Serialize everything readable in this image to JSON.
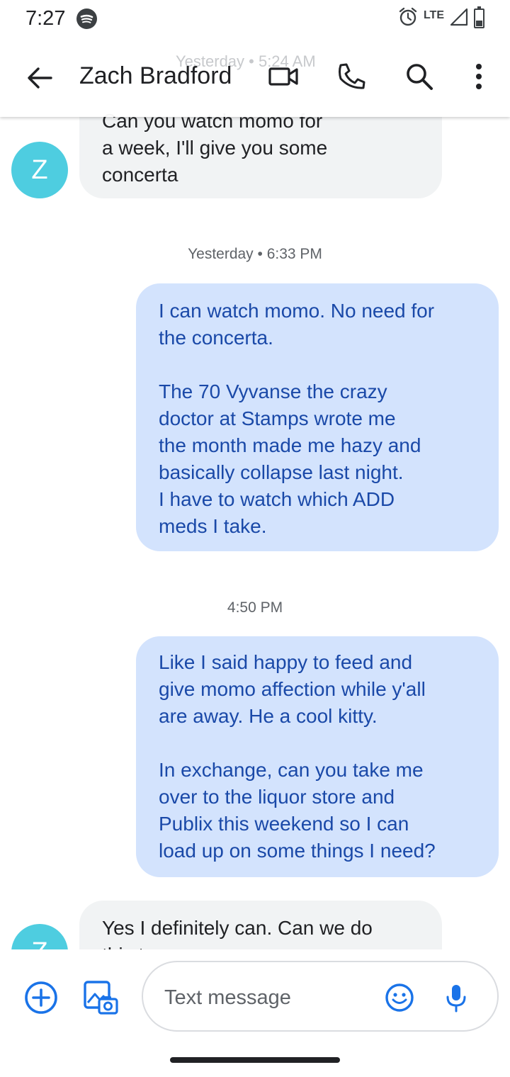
{
  "status_bar": {
    "time": "7:27",
    "network": "LTE",
    "battery": "33",
    "battery_fraction": 0.33,
    "icons": [
      "spotify-icon",
      "alarm-icon",
      "signal-icon",
      "battery-icon"
    ]
  },
  "toolbar": {
    "contact_name": "Zach Bradford",
    "behind_timestamp": "Yesterday • 5:24 AM",
    "icons": [
      "back-arrow-icon",
      "video-call-icon",
      "phone-icon",
      "search-icon",
      "more-vert-icon"
    ]
  },
  "colors": {
    "accent": "#1a73e8",
    "avatar": "#4ecde0",
    "incoming_bubble": "#f1f3f4",
    "outgoing_bubble": "#d3e3fd",
    "outgoing_text": "#1a49a8"
  },
  "messages": [
    {
      "direction": "incoming",
      "avatar_letter": "Z",
      "text": "Can you watch momo for\na week, I'll give you some\nconcerta"
    },
    {
      "timestamp": "Yesterday • 6:33 PM",
      "direction": "outgoing",
      "text": "I can watch momo. No need for\nthe concerta.\n\nThe 70 Vyvanse the crazy\ndoctor at Stamps wrote me\nthe month made me hazy and\nbasically collapse last night.\nI have  to watch which ADD\nmeds I take."
    },
    {
      "timestamp": "4:50 PM",
      "direction": "outgoing",
      "text": "Like I said happy to feed and\ngive momo affection while y'all\nare away. He a cool kitty.\n\nIn exchange, can you take me\nover to the liquor store and\nPublix this weekend so I can\nload up on some things I need?"
    },
    {
      "direction": "incoming",
      "avatar_letter": "Z",
      "text": "Yes I definitely can. Can we do\nthis tomorrow"
    }
  ],
  "compose": {
    "placeholder": "Text message",
    "icons": [
      "add-icon",
      "gallery-camera-icon",
      "emoji-icon",
      "microphone-icon"
    ]
  }
}
